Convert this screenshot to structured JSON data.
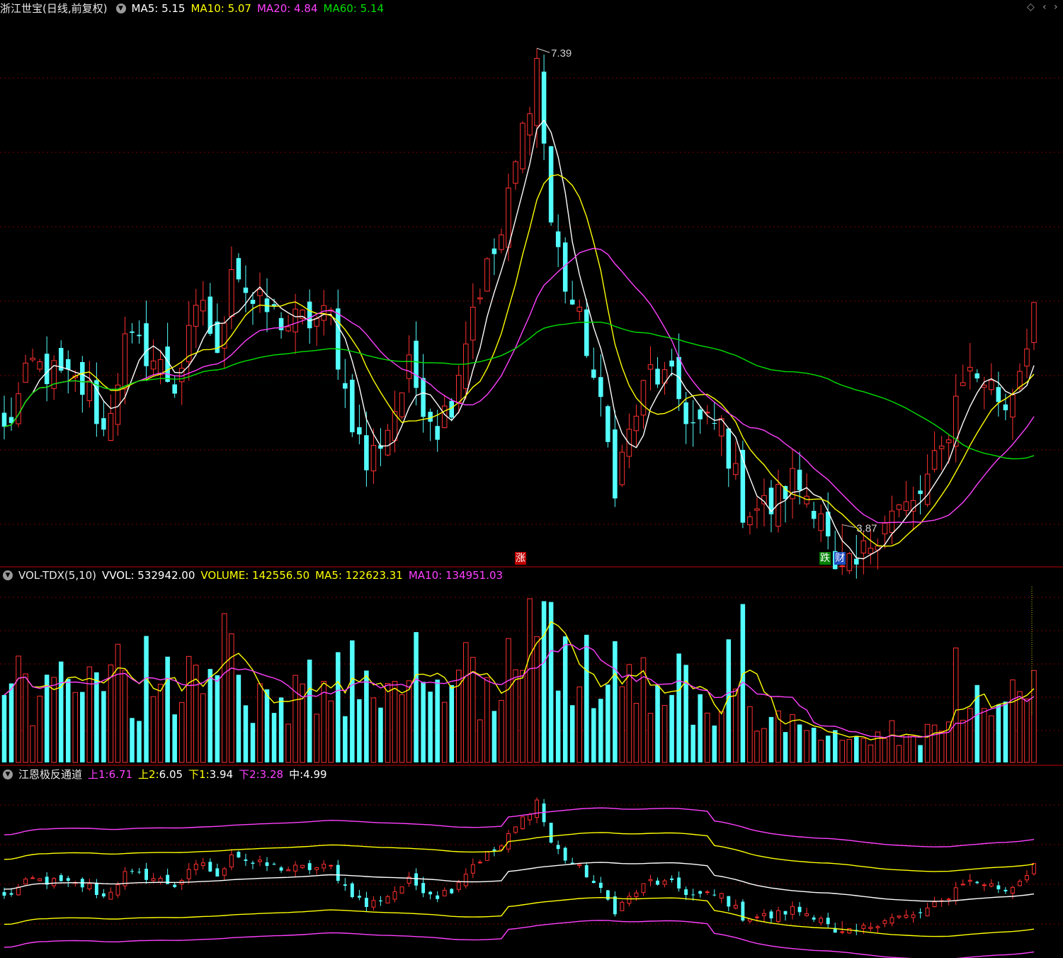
{
  "window": {
    "stock_name": "浙江世宝",
    "period": "(日线,前复权)",
    "corner_icons": [
      "diamond-icon",
      "chevron-left-icon",
      "chevron-right-icon"
    ]
  },
  "main_panel": {
    "indicators": [
      {
        "label": "MA5: 5.15",
        "color": "#ffffff"
      },
      {
        "label": "MA10: 5.07",
        "color": "#ffff00"
      },
      {
        "label": "MA20: 4.84",
        "color": "#ff40ff"
      },
      {
        "label": "MA60: 5.14",
        "color": "#00e000"
      }
    ],
    "high_label": "7.39",
    "low_label": "3.87",
    "tags": [
      {
        "text": "涨",
        "bg": "#c00000"
      },
      {
        "text": "跌",
        "bg": "#008000"
      },
      {
        "text": "财",
        "bg": "#2050c0"
      }
    ]
  },
  "volume_panel": {
    "title": "VOL-TDX(5,10)",
    "indicators": [
      {
        "label": "VVOL: 532942.00",
        "color": "#ffffff"
      },
      {
        "label": "VOLUME: 142556.50",
        "color": "#ffff00"
      },
      {
        "label": "MA5: 122623.31",
        "color": "#ffff00"
      },
      {
        "label": "MA10: 134951.03",
        "color": "#ff40ff"
      }
    ]
  },
  "channel_panel": {
    "title": "江恩极反通道",
    "indicators": [
      {
        "key": "上1:",
        "value": "6.71",
        "color": "#ff40ff"
      },
      {
        "key": "上2:",
        "value": "6.05",
        "color": "#ffff00"
      },
      {
        "key": "下1:",
        "value": "3.94",
        "color": "#ffff00"
      },
      {
        "key": "下2:",
        "value": "3.28",
        "color": "#ff40ff"
      },
      {
        "key": "中:",
        "value": "4.99",
        "color": "#ffffff"
      }
    ]
  },
  "chart_data": {
    "type": "candlestick",
    "bars": 146,
    "price_range": [
      3.6,
      7.6
    ],
    "anchors": [
      [
        0,
        4.55
      ],
      [
        4,
        5.05
      ],
      [
        8,
        4.95
      ],
      [
        12,
        4.85
      ],
      [
        14,
        4.55
      ],
      [
        17,
        5.2
      ],
      [
        20,
        5.15
      ],
      [
        24,
        4.9
      ],
      [
        28,
        5.55
      ],
      [
        30,
        5.05
      ],
      [
        32,
        5.85
      ],
      [
        35,
        5.5
      ],
      [
        37,
        5.45
      ],
      [
        40,
        5.35
      ],
      [
        46,
        5.4
      ],
      [
        48,
        4.85
      ],
      [
        51,
        4.3
      ],
      [
        54,
        4.6
      ],
      [
        57,
        5.0
      ],
      [
        61,
        4.6
      ],
      [
        63,
        4.8
      ],
      [
        66,
        5.5
      ],
      [
        70,
        6.0
      ],
      [
        75,
        7.3
      ],
      [
        77,
        6.1
      ],
      [
        79,
        5.65
      ],
      [
        82,
        5.2
      ],
      [
        86,
        4.2
      ],
      [
        89,
        4.7
      ],
      [
        91,
        5.0
      ],
      [
        94,
        4.9
      ],
      [
        97,
        4.6
      ],
      [
        101,
        4.6
      ],
      [
        104,
        4.0
      ],
      [
        108,
        4.0
      ],
      [
        111,
        4.2
      ],
      [
        115,
        4.0
      ],
      [
        117,
        3.45
      ],
      [
        120,
        3.55
      ],
      [
        124,
        3.95
      ],
      [
        128,
        4.0
      ],
      [
        132,
        4.4
      ],
      [
        135,
        5.0
      ],
      [
        138,
        4.95
      ],
      [
        141,
        4.75
      ],
      [
        143,
        5.05
      ],
      [
        145,
        5.5
      ]
    ],
    "spikes": {
      "75": 7.39,
      "118": 3.87
    },
    "volume_peaks": {
      "31": 1.0,
      "74": 1.1,
      "64": 0.62,
      "17": 0.62,
      "137": 0.52
    },
    "channel": {
      "upper1_range": [
        6.3,
        7.6
      ],
      "upper2_range": [
        5.7,
        6.9
      ],
      "mid_range": [
        4.8,
        5.8
      ],
      "lower1_range": [
        3.6,
        4.6
      ],
      "lower2_range": [
        3.0,
        4.0
      ]
    }
  }
}
